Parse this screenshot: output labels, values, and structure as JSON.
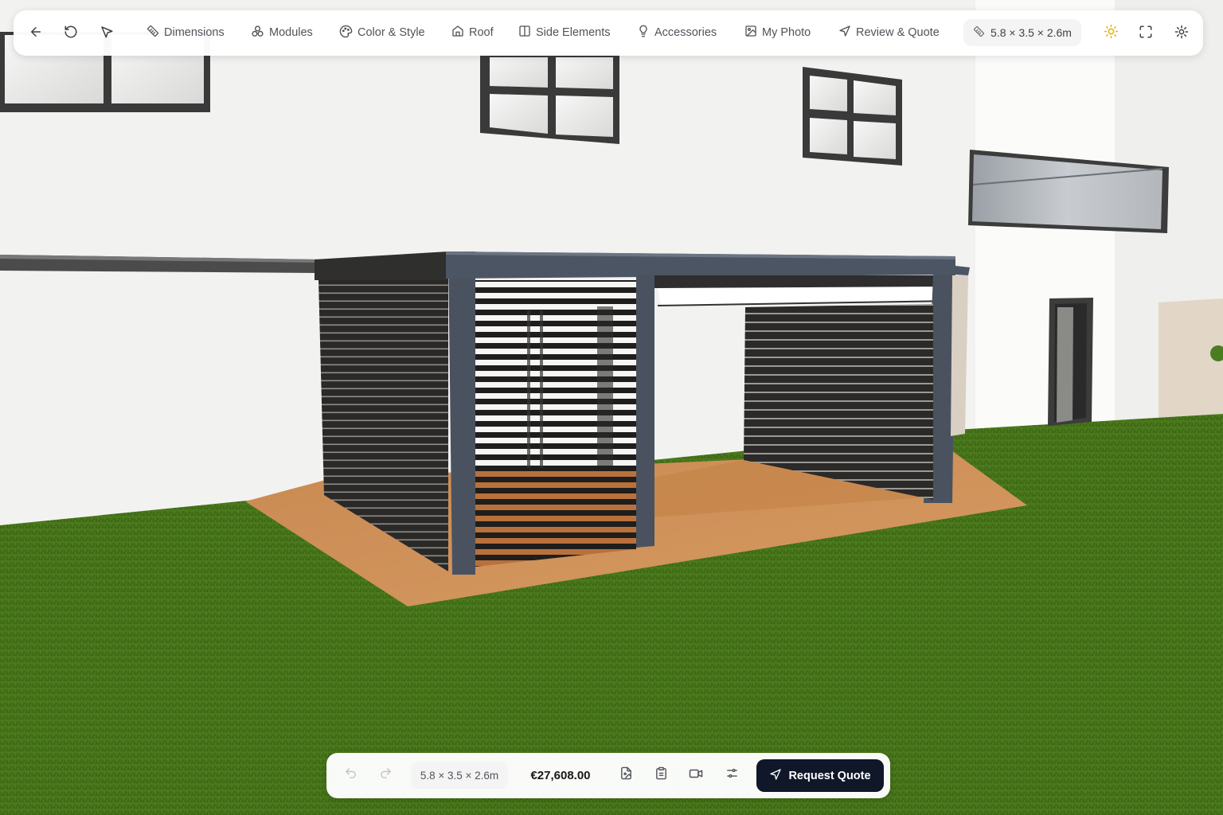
{
  "toolbar": {
    "back_icon": "arrow-left-icon",
    "reset_icon": "rotate-ccw-icon",
    "select_icon": "mouse-pointer-icon",
    "nav": [
      {
        "label": "Dimensions",
        "icon": "ruler-icon"
      },
      {
        "label": "Modules",
        "icon": "boxes-icon"
      },
      {
        "label": "Color & Style",
        "icon": "palette-icon"
      },
      {
        "label": "Roof",
        "icon": "home-icon"
      },
      {
        "label": "Side Elements",
        "icon": "panel-icon"
      },
      {
        "label": "Accessories",
        "icon": "lightbulb-icon"
      },
      {
        "label": "My Photo",
        "icon": "image-icon"
      },
      {
        "label": "Review & Quote",
        "icon": "send-icon"
      }
    ],
    "dimensions": "5.8 × 3.5 × 2.6m",
    "right_icons": [
      "sun-icon",
      "fullscreen-icon",
      "settings-icon"
    ],
    "accent_color": "#eab308"
  },
  "bottom_bar": {
    "undo_icon": "undo-icon",
    "redo_icon": "redo-icon",
    "dimensions": "5.8 × 3.5 × 2.6m",
    "price": "€27,608.00",
    "icons": [
      "file-image-icon",
      "clipboard-icon",
      "video-icon",
      "sliders-icon"
    ],
    "request_quote_label": "Request Quote",
    "button_color": "#0f1729"
  },
  "scene": {
    "grass_color": "#4f7a1f",
    "wall_color": "#f4f4f2",
    "frame_color": "#4b5563",
    "deck_color": "#c8874e"
  }
}
